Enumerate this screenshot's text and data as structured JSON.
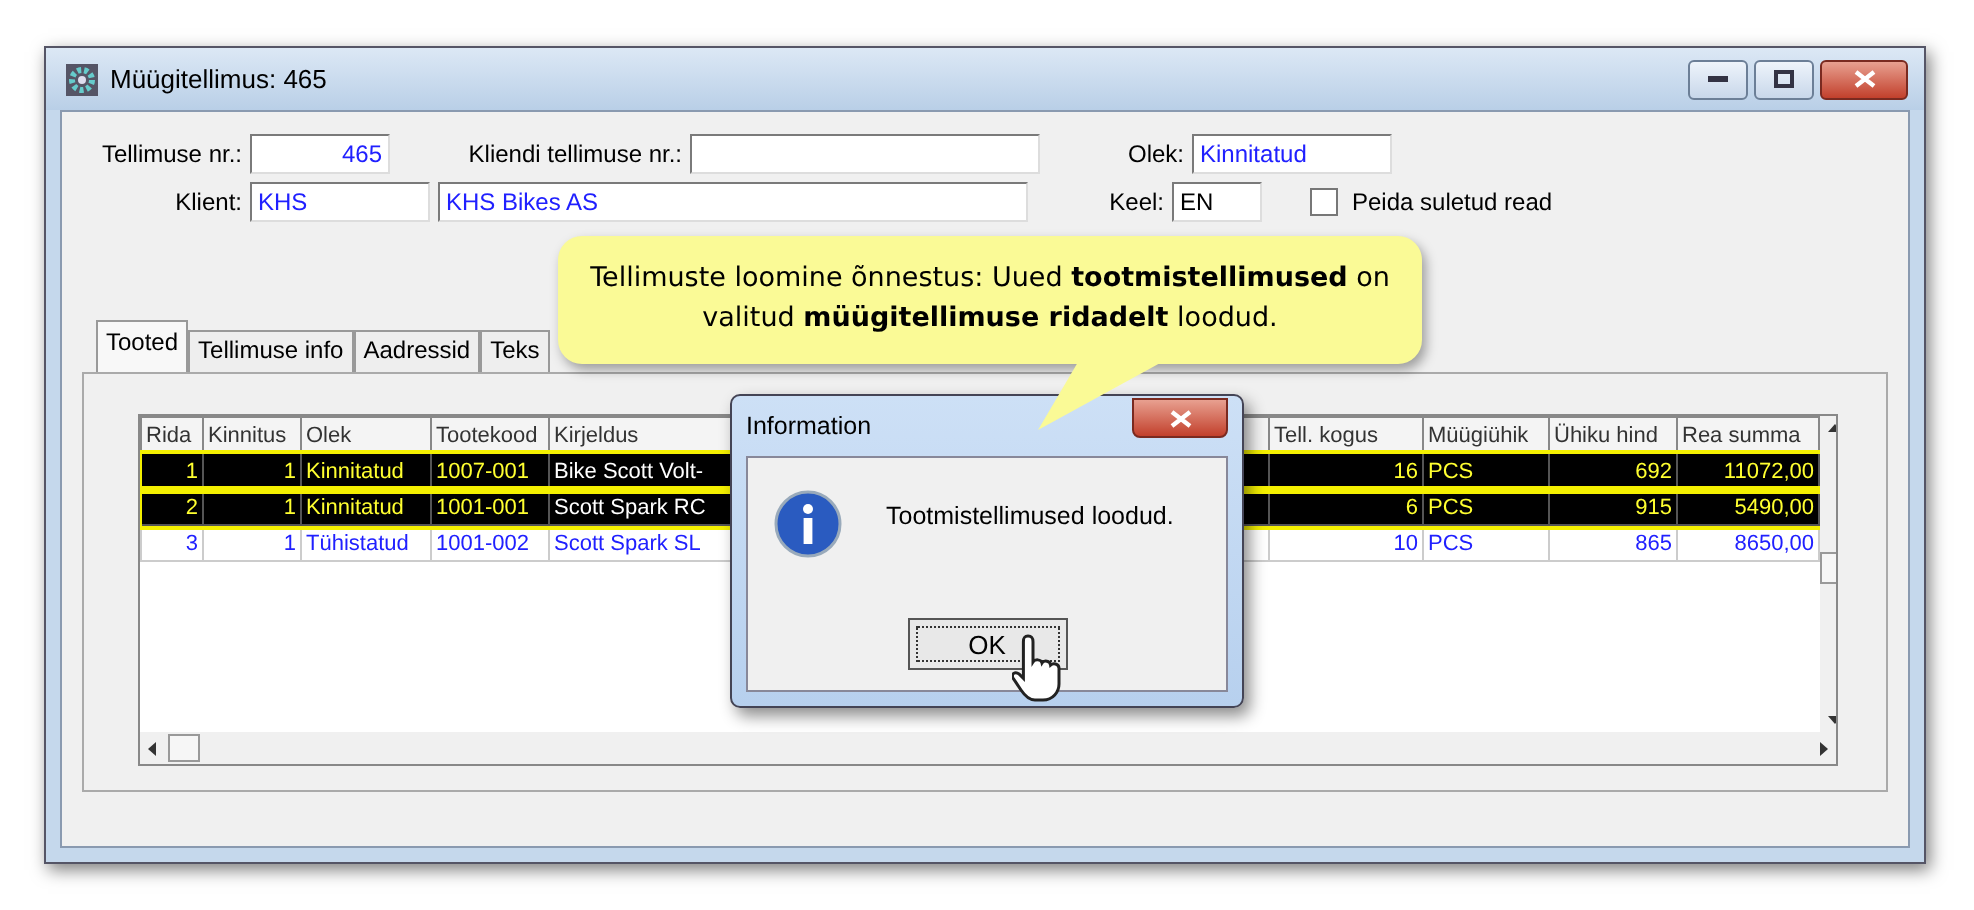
{
  "window": {
    "title": "Müügitellimus: 465"
  },
  "form": {
    "order_no": {
      "label": "Tellimuse nr.:",
      "value": "465"
    },
    "customer_order_no": {
      "label": "Kliendi tellimuse nr.:"
    },
    "status": {
      "label": "Olek:",
      "value": "Kinnitatud"
    },
    "client": {
      "label": "Klient:",
      "code": "KHS",
      "name": "KHS Bikes AS"
    },
    "language": {
      "label": "Keel:",
      "value": "EN"
    },
    "hide_closed": {
      "label": "Peida suletud read",
      "checked": false
    }
  },
  "tabs": [
    {
      "label": "Tooted",
      "selected": true
    },
    {
      "label": "Tellimuse info",
      "selected": false
    },
    {
      "label": "Aadressid",
      "selected": false
    },
    {
      "label": "Teks",
      "selected": false
    }
  ],
  "table": {
    "columns": [
      "Rida",
      "Kinnitus",
      "Olek",
      "Tootekood",
      "Kirjeldus",
      "Tell. kogus",
      "Müügiühik",
      "Ühiku hind",
      "Rea summa"
    ],
    "rows": [
      {
        "selected": true,
        "cells": [
          "1",
          "1",
          "Kinnitatud",
          "1007-001",
          "Bike Scott Volt-",
          "16",
          "PCS",
          "692",
          "11072,00"
        ]
      },
      {
        "selected": true,
        "cells": [
          "2",
          "1",
          "Kinnitatud",
          "1001-001",
          "Scott Spark RC",
          "6",
          "PCS",
          "915",
          "5490,00"
        ]
      },
      {
        "selected": false,
        "cells": [
          "3",
          "1",
          "Tühistatud",
          "1001-002",
          "Scott Spark SL",
          "10",
          "PCS",
          "865",
          "8650,00"
        ]
      }
    ]
  },
  "dialog": {
    "title": "Information",
    "message": "Tootmistellimused loodud.",
    "button": "OK"
  },
  "callout": {
    "text": "Tellimuste loomine õnnestus: Uued **tootmistellimused** on valitud **müügitellimuse ridadelt** loodud."
  }
}
